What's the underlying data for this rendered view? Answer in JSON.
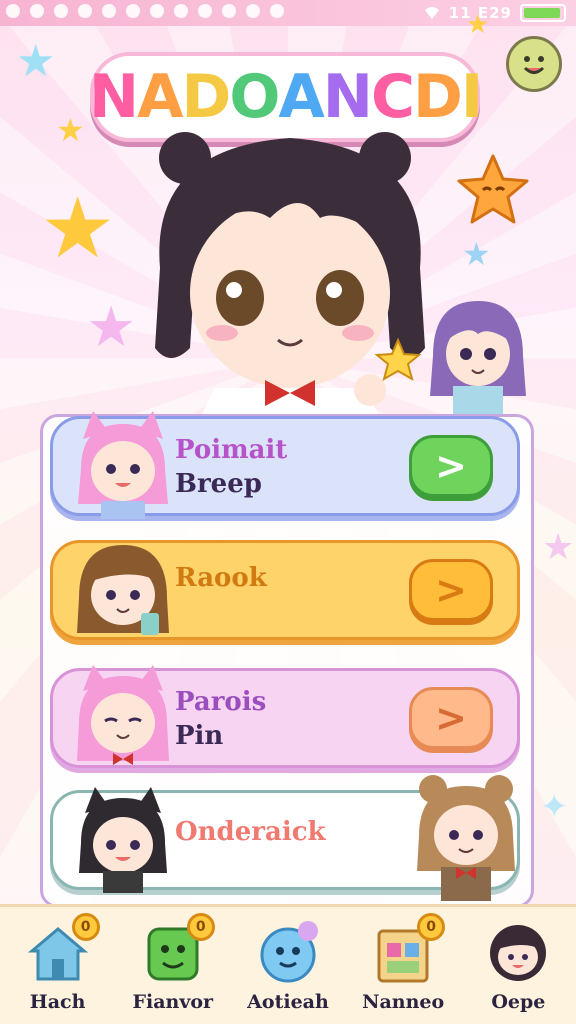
{
  "status_bar": {
    "time": "11 E29",
    "battery_level": 0.95
  },
  "app_title": {
    "letters": [
      "N",
      "A",
      "D",
      "O",
      "A",
      "N",
      "C",
      "D",
      "I"
    ]
  },
  "menu": {
    "items": [
      {
        "title": "Poimait",
        "subtitle": "Breep",
        "action": "go"
      },
      {
        "title": "Raook",
        "subtitle": "",
        "action": "go"
      },
      {
        "title": "Parois",
        "subtitle": "Pin",
        "action": "go"
      },
      {
        "title": "Onderaick",
        "subtitle": "",
        "action": ""
      }
    ],
    "go_glyph": ">"
  },
  "bottom_nav": {
    "items": [
      {
        "label": "Hach",
        "icon": "house-icon",
        "badge": "0"
      },
      {
        "label": "Fianvor",
        "icon": "green-monster-icon",
        "badge": "0"
      },
      {
        "label": "Aotieah",
        "icon": "blue-blob-icon",
        "badge": ""
      },
      {
        "label": "Nanneo",
        "icon": "shop-box-icon",
        "badge": "0"
      },
      {
        "label": "Oepe",
        "icon": "girl-avatar-icon",
        "badge": ""
      }
    ]
  },
  "colors": {
    "accent_pink": "#ff5fa2",
    "go_green": "#6fd45c",
    "go_orange": "#ffbd3a",
    "nav_bg": "#fdf3df"
  }
}
